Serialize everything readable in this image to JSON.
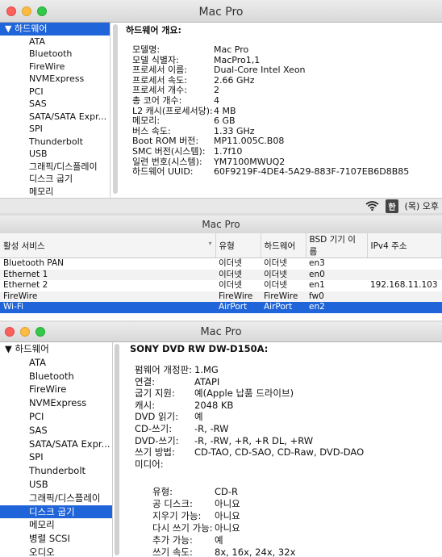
{
  "win1": {
    "title": "Mac Pro",
    "sidebar": [
      {
        "label": "▼ 하드웨어",
        "head": true,
        "selected": true
      },
      {
        "label": "ATA"
      },
      {
        "label": "Bluetooth"
      },
      {
        "label": "FireWire"
      },
      {
        "label": "NVMExpress"
      },
      {
        "label": "PCI"
      },
      {
        "label": "SAS"
      },
      {
        "label": "SATA/SATA Expr..."
      },
      {
        "label": "SPI"
      },
      {
        "label": "Thunderbolt"
      },
      {
        "label": "USB"
      },
      {
        "label": "그래픽/디스플레이"
      },
      {
        "label": "디스크 굽기"
      },
      {
        "label": "메모리"
      }
    ],
    "section_title": "하드웨어 개요:",
    "rows": [
      {
        "k": "모델명:",
        "v": "Mac Pro"
      },
      {
        "k": "모델 식별자:",
        "v": "MacPro1,1"
      },
      {
        "k": "프로세서 이름:",
        "v": "Dual-Core Intel Xeon"
      },
      {
        "k": "프로세서 속도:",
        "v": "2.66 GHz"
      },
      {
        "k": "프로세서 개수:",
        "v": "2"
      },
      {
        "k": "총 코어 개수:",
        "v": "4"
      },
      {
        "k": "L2 캐시(프로세서당):",
        "v": "4 MB"
      },
      {
        "k": "메모리:",
        "v": "6 GB"
      },
      {
        "k": "버스 속도:",
        "v": "1.33 GHz"
      },
      {
        "k": "Boot ROM 버전:",
        "v": "MP11.005C.B08"
      },
      {
        "k": "SMC 버전(시스템):",
        "v": "1.7f10"
      },
      {
        "k": "일련 번호(시스템):",
        "v": "YM7100MWUQ2"
      },
      {
        "k": "하드웨어 UUID:",
        "v": "60F9219F-4DE4-5A29-883F-7107EB6D8B85"
      }
    ],
    "status": {
      "input_badge": "한",
      "clock": "(목) 오후"
    }
  },
  "win2": {
    "title": "Mac Pro",
    "columns": [
      "활성 서비스",
      "유형",
      "하드웨어",
      "BSD 기기 이름",
      "IPv4 주소"
    ],
    "rows": [
      {
        "service": "Bluetooth PAN",
        "type": "이더넷",
        "hw": "이더넷",
        "bsd": "en3",
        "ip": ""
      },
      {
        "service": "Ethernet 1",
        "type": "이더넷",
        "hw": "이더넷",
        "bsd": "en0",
        "ip": ""
      },
      {
        "service": "Ethernet 2",
        "type": "이더넷",
        "hw": "이더넷",
        "bsd": "en1",
        "ip": "192.168.11.103"
      },
      {
        "service": "FireWire",
        "type": "FireWire",
        "hw": "FireWire",
        "bsd": "fw0",
        "ip": ""
      },
      {
        "service": "Wi-Fi",
        "type": "AirPort",
        "hw": "AirPort",
        "bsd": "en2",
        "ip": "",
        "selected": true
      }
    ]
  },
  "win3": {
    "title": "Mac Pro",
    "sidebar": [
      {
        "label": "▼ 하드웨어",
        "head": true
      },
      {
        "label": "ATA"
      },
      {
        "label": "Bluetooth"
      },
      {
        "label": "FireWire"
      },
      {
        "label": "NVMExpress"
      },
      {
        "label": "PCI"
      },
      {
        "label": "SAS"
      },
      {
        "label": "SATA/SATA Expr..."
      },
      {
        "label": "SPI"
      },
      {
        "label": "Thunderbolt"
      },
      {
        "label": "USB"
      },
      {
        "label": "그래픽/디스플레이"
      },
      {
        "label": "디스크 굽기",
        "selected": true
      },
      {
        "label": "메모리"
      },
      {
        "label": "병렬 SCSI"
      },
      {
        "label": "오디오"
      }
    ],
    "section_title": "SONY DVD RW DW-D150A:",
    "rows": [
      {
        "k": "펌웨어 개정판:",
        "v": "1.MG"
      },
      {
        "k": "연결:",
        "v": "ATAPI"
      },
      {
        "k": "굽기 지원:",
        "v": "예(Apple 납품 드라이브)"
      },
      {
        "k": "캐시:",
        "v": "2048 KB"
      },
      {
        "k": "DVD 읽기:",
        "v": "예"
      },
      {
        "k": "CD-쓰기:",
        "v": "-R, -RW"
      },
      {
        "k": "DVD-쓰기:",
        "v": "-R, -RW, +R, +R DL, +RW"
      },
      {
        "k": "쓰기 방법:",
        "v": "CD-TAO, CD-SAO, CD-Raw, DVD-DAO"
      },
      {
        "k": "미디어:",
        "v": ""
      }
    ],
    "media_rows": [
      {
        "k": "유형:",
        "v": "CD-R"
      },
      {
        "k": "공 디스크:",
        "v": "아니요"
      },
      {
        "k": "지우기 가능:",
        "v": "아니요"
      },
      {
        "k": "다시 쓰기 가능:",
        "v": "아니요"
      },
      {
        "k": "추가 가능:",
        "v": "예"
      },
      {
        "k": "쓰기 속도:",
        "v": "8x, 16x, 24x, 32x"
      }
    ]
  }
}
